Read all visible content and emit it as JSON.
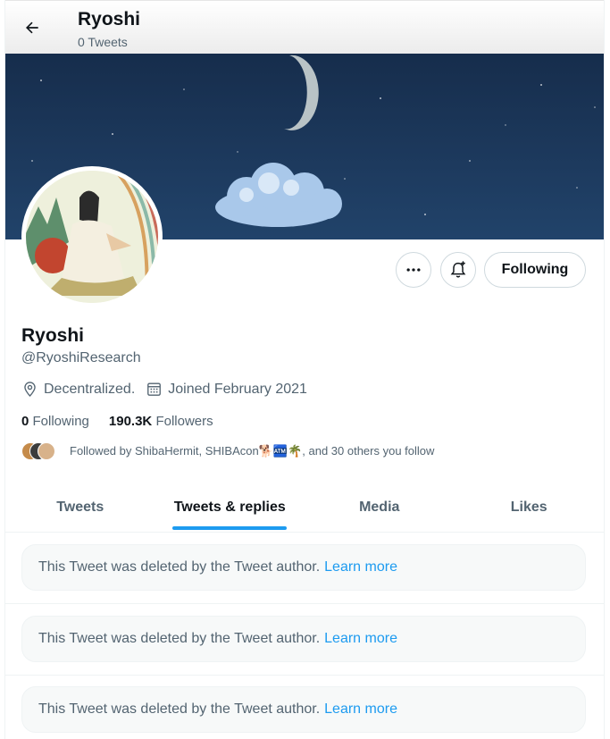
{
  "header": {
    "name": "Ryoshi",
    "tweet_count": "0 Tweets"
  },
  "profile": {
    "name": "Ryoshi",
    "handle": "@RyoshiResearch",
    "location": "Decentralized.",
    "joined": "Joined February 2021",
    "following_count": "0",
    "following_label": "Following",
    "followers_count": "190.3K",
    "followers_label": "Followers",
    "followed_by": "Followed by ShibaHermit, SHIBAcon🐕🏧🌴, and 30 others you follow"
  },
  "actions": {
    "following_button": "Following"
  },
  "tabs": [
    {
      "label": "Tweets",
      "active": false
    },
    {
      "label": "Tweets & replies",
      "active": true
    },
    {
      "label": "Media",
      "active": false
    },
    {
      "label": "Likes",
      "active": false
    }
  ],
  "deleted_tweets": [
    {
      "text": "This Tweet was deleted by the Tweet author.",
      "link": "Learn more"
    },
    {
      "text": "This Tweet was deleted by the Tweet author.",
      "link": "Learn more"
    },
    {
      "text": "This Tweet was deleted by the Tweet author.",
      "link": "Learn more"
    }
  ],
  "colors": {
    "accent": "#1d9bf0",
    "text_primary": "#0f1419",
    "text_secondary": "#536471",
    "banner": "#1d3a5e"
  },
  "icons": [
    "back-arrow-icon",
    "more-icon",
    "notification-bell-icon",
    "location-pin-icon",
    "calendar-icon"
  ]
}
